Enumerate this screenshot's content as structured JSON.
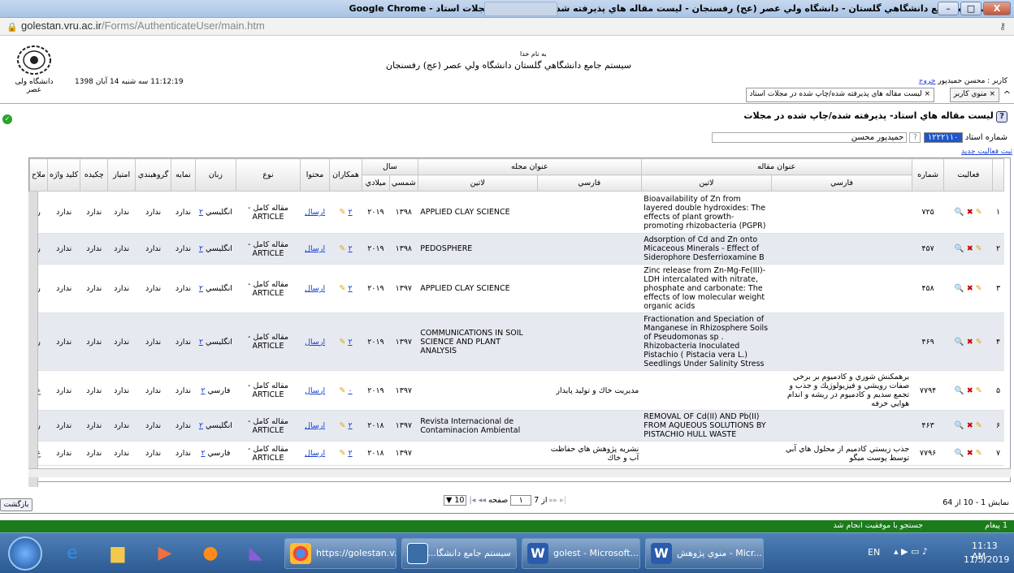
{
  "window": {
    "title": "سیستم جامع دانشگاهي گلستان - دانشگاه ولي عصر (عج) رفسنجان - ليست مقاله هاي پذيرفته شده/چاپ شده در مجلات استاد - Google Chrome",
    "min": "–",
    "max": "□",
    "close": "X"
  },
  "address": {
    "host": "golestan.vru.ac.ir",
    "path": "/Forms/AuthenticateUser/main.htm"
  },
  "header": {
    "bismillah": "به نام خدا",
    "system_name": "سيستم جامع دانشگاهي گلستان  دانشگاه ولي عصر (عج) رفسنجان",
    "datetime": "11:12:19 سه شنبه 14 آبان 1398",
    "user_label": "كاربر : محسن حميدپور",
    "logout": "خروج",
    "logo_text": "دانشگاه ولی عصر"
  },
  "tabs": [
    {
      "label": "منوي كاربر",
      "close": "×"
    },
    {
      "label": "ليست مقاله هاي پذيرفته شده/چاپ شده در مجلات استاد",
      "close": "×"
    }
  ],
  "form": {
    "title": "ليست مقاله هاي استاد- پذيرفته شده/چاپ شده در مجلات",
    "prof_label": "شماره استاد",
    "prof_number": "۱۲۲۲۱۱۰",
    "prof_name": "حميدپور محسن",
    "new_activity": "ثبت فعاليت جديد"
  },
  "columns": {
    "activity": "فعاليت",
    "number": "شماره",
    "article_title": "عنوان مقاله",
    "farsi": "فارسي",
    "latin": "لاتين",
    "journal_title": "عنوان مجله",
    "year": "سال",
    "year_shamsi": "شمسي",
    "year_miladi": "ميلادي",
    "coauthors": "همكاران",
    "content": "محتوا",
    "type": "نوع",
    "language": "زبان",
    "index": "نمايه",
    "grouping": "گروهبندي",
    "score": "امتياز",
    "abstract": "چكيده",
    "keyword": "كليد واژه",
    "note": "ملاح"
  },
  "rows": [
    {
      "idx": "۱",
      "num": "۷۲۵",
      "title_fa": "",
      "title_en": "Bioavailability of Zn from layered double hydroxides: The effects of plant growth-promoting rhizobacteria (PGPR)",
      "journal_fa": "",
      "journal_en": "APPLIED CLAY SCIENCE",
      "shamsi": "۱۳۹۸",
      "miladi": "۲۰۱۹",
      "co": "۲",
      "content": "ارسال",
      "type": "مقاله كامل - ARTICLE",
      "lang": "انگليسي",
      "lang_mark": "۲",
      "index": "ندارد",
      "group": "ندارد",
      "score": "ندارد",
      "abstract": "ندارد",
      "keyword": "ندارد",
      "note": "ر"
    },
    {
      "idx": "۲",
      "num": "۴۵۷",
      "title_fa": "",
      "title_en": "Adsorption of Cd and Zn onto Micaceous Minerals - Effect of Siderophore Desferrioxamine B",
      "journal_fa": "",
      "journal_en": "PEDOSPHERE",
      "shamsi": "۱۳۹۸",
      "miladi": "۲۰۱۹",
      "co": "۲",
      "content": "ارسال",
      "type": "مقاله كامل - ARTICLE",
      "lang": "انگليسي",
      "lang_mark": "۲",
      "index": "ندارد",
      "group": "ندارد",
      "score": "ندارد",
      "abstract": "ندارد",
      "keyword": "ندارد",
      "note": "ر"
    },
    {
      "idx": "۳",
      "num": "۴۵۸",
      "title_fa": "",
      "title_en": "Zinc release from Zn-Mg-Fe(III)-LDH intercalated with nitrate, phosphate and carbonate: The effects of low molecular weight organic acids",
      "journal_fa": "",
      "journal_en": "APPLIED CLAY SCIENCE",
      "shamsi": "۱۳۹۷",
      "miladi": "۲۰۱۹",
      "co": "۲",
      "content": "ارسال",
      "type": "مقاله كامل - ARTICLE",
      "lang": "انگليسي",
      "lang_mark": "۲",
      "index": "ندارد",
      "group": "ندارد",
      "score": "ندارد",
      "abstract": "ندارد",
      "keyword": "ندارد",
      "note": "ر"
    },
    {
      "idx": "۴",
      "num": "۴۶۹",
      "title_fa": "",
      "title_en": "Fractionation and Speciation of Manganese in Rhizosphere Soils of Pseudomonas sp . Rhizobacteria Inoculated Pistachio ( Pistacia vera L.) Seedlings Under Salinity Stress",
      "journal_fa": "",
      "journal_en": "COMMUNICATIONS IN SOIL SCIENCE AND PLANT ANALYSIS",
      "shamsi": "۱۳۹۷",
      "miladi": "۲۰۱۹",
      "co": "۲",
      "content": "ارسال",
      "type": "مقاله كامل - ARTICLE",
      "lang": "انگليسي",
      "lang_mark": "۲",
      "index": "ندارد",
      "group": "ندارد",
      "score": "ندارد",
      "abstract": "ندارد",
      "keyword": "ندارد",
      "note": "ر"
    },
    {
      "idx": "۵",
      "num": "۷۷۹۴",
      "title_fa": "برهمكنش شوري و كادميوم بر برخي صفات رويشي و فيزيولوژيك و جذب و تجمع سديم و كادميوم در ريشه و اندام هوايي خرفه",
      "title_en": "",
      "journal_fa": "مديريت خاك و توليد پايدار",
      "journal_en": "",
      "shamsi": "۱۳۹۷",
      "miladi": "۲۰۱۹",
      "co": "۰",
      "content": "ارسال",
      "type": "مقاله كامل - ARTICLE",
      "lang": "فارسي",
      "lang_mark": "۲",
      "index": "ندارد",
      "group": "ندارد",
      "score": "ندارد",
      "abstract": "ندارد",
      "keyword": "ندارد",
      "note": "ع"
    },
    {
      "idx": "۶",
      "num": "۴۶۳",
      "title_fa": "",
      "title_en": "REMOVAL OF Cd(II) AND Pb(II) FROM AQUEOUS SOLUTIONS BY PISTACHIO HULL WASTE",
      "journal_fa": "",
      "journal_en": "Revista Internacional de Contaminacion Ambiental",
      "shamsi": "۱۳۹۷",
      "miladi": "۲۰۱۸",
      "co": "۲",
      "content": "ارسال",
      "type": "مقاله كامل - ARTICLE",
      "lang": "انگليسي",
      "lang_mark": "۲",
      "index": "ندارد",
      "group": "ندارد",
      "score": "ندارد",
      "abstract": "ندارد",
      "keyword": "ندارد",
      "note": "ر"
    },
    {
      "idx": "۷",
      "num": "۷۷۹۶",
      "title_fa": "جذب زيستي كادميم از محلول هاي آبي توسط پوست ميگو",
      "title_en": "",
      "journal_fa": "نشريه پژوهش هاي حفاظت آب و خاك",
      "journal_en": "",
      "shamsi": "۱۳۹۷",
      "miladi": "۲۰۱۸",
      "co": "۲",
      "content": "ارسال",
      "type": "مقاله كامل - ARTICLE",
      "lang": "فارسي",
      "lang_mark": "۲",
      "index": "ندارد",
      "group": "ندارد",
      "score": "ندارد",
      "abstract": "ندارد",
      "keyword": "ندارد",
      "note": "ع"
    }
  ],
  "pager": {
    "summary": "نمايش 1 - 10 از 64",
    "page_label": "صفحه",
    "page_value": "۱",
    "of_label": "از 7",
    "page_size": "10"
  },
  "back_button": "بازگشت",
  "status": {
    "message": "جستجو با موفقيت انجام شد",
    "count": "1 پيغام"
  },
  "taskbar": {
    "items": [
      "https://golestan.v...",
      "سيستم جامع دانشگا...",
      "golest - Microsoft...",
      "منوي پژوهش - Micr..."
    ],
    "lang": "EN",
    "time": "11:13 AM",
    "date": "11/5/2019"
  }
}
